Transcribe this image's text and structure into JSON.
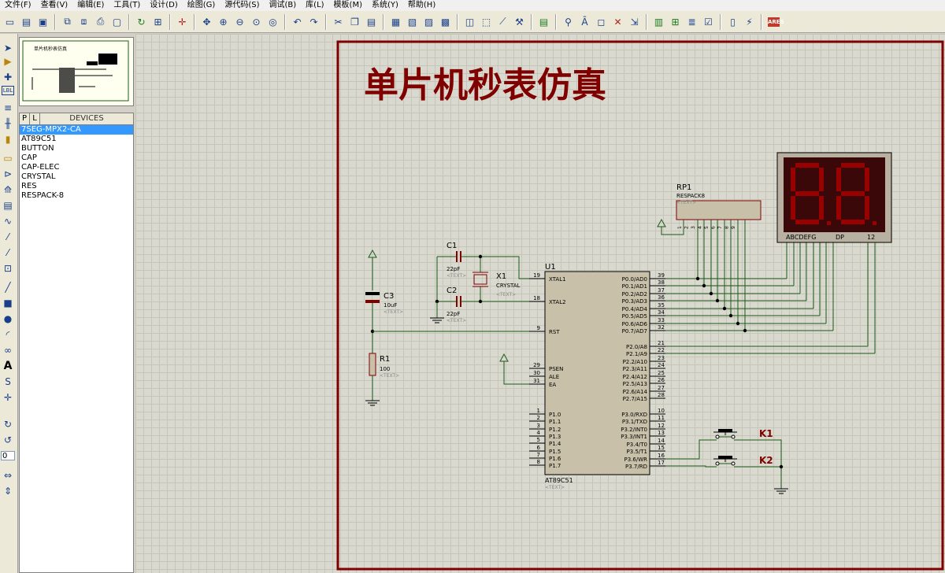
{
  "menu": [
    "文件(F)",
    "查看(V)",
    "编辑(E)",
    "工具(T)",
    "设计(D)",
    "绘图(G)",
    "源代码(S)",
    "调试(B)",
    "库(L)",
    "模板(M)",
    "系统(Y)",
    "帮助(H)"
  ],
  "left_tool_value": "0",
  "panel": {
    "tab_p": "P",
    "tab_l": "L",
    "header": "DEVICES",
    "selected_index": 0,
    "devices": [
      "7SEG-MPX2-CA",
      "AT89C51",
      "BUTTON",
      "CAP",
      "CAP-ELEC",
      "CRYSTAL",
      "RES",
      "RESPACK-8"
    ]
  },
  "overview": {
    "title": "单片机秒表仿真"
  },
  "schematic": {
    "title": "单片机秒表仿真",
    "colors": {
      "frame": "#800000",
      "wire": "#1a5c1a",
      "chip_fill": "#c8c0a8",
      "component": "#800000",
      "segment": "#990000",
      "display_bg": "#3a0808"
    },
    "u1": {
      "ref": "U1",
      "name": "AT89C51",
      "text": "<TEXT>",
      "left_pins": [
        {
          "num": "19",
          "name": "XTAL1"
        },
        {
          "num": "18",
          "name": "XTAL2"
        },
        {
          "num": "9",
          "name": "RST"
        },
        {
          "num": "29",
          "name": "PSEN"
        },
        {
          "num": "30",
          "name": "ALE"
        },
        {
          "num": "31",
          "name": "EA"
        },
        {
          "num": "1",
          "name": "P1.0"
        },
        {
          "num": "2",
          "name": "P1.1"
        },
        {
          "num": "3",
          "name": "P1.2"
        },
        {
          "num": "4",
          "name": "P1.3"
        },
        {
          "num": "5",
          "name": "P1.4"
        },
        {
          "num": "6",
          "name": "P1.5"
        },
        {
          "num": "7",
          "name": "P1.6"
        },
        {
          "num": "8",
          "name": "P1.7"
        }
      ],
      "right_pins": [
        {
          "num": "39",
          "name": "P0.0/AD0"
        },
        {
          "num": "38",
          "name": "P0.1/AD1"
        },
        {
          "num": "37",
          "name": "P0.2/AD2"
        },
        {
          "num": "36",
          "name": "P0.3/AD3"
        },
        {
          "num": "35",
          "name": "P0.4/AD4"
        },
        {
          "num": "34",
          "name": "P0.5/AD5"
        },
        {
          "num": "33",
          "name": "P0.6/AD6"
        },
        {
          "num": "32",
          "name": "P0.7/AD7"
        },
        {
          "num": "21",
          "name": "P2.0/A8"
        },
        {
          "num": "22",
          "name": "P2.1/A9"
        },
        {
          "num": "23",
          "name": "P2.2/A10"
        },
        {
          "num": "24",
          "name": "P2.3/A11"
        },
        {
          "num": "25",
          "name": "P2.4/A12"
        },
        {
          "num": "26",
          "name": "P2.5/A13"
        },
        {
          "num": "27",
          "name": "P2.6/A14"
        },
        {
          "num": "28",
          "name": "P2.7/A15"
        },
        {
          "num": "10",
          "name": "P3.0/RXD"
        },
        {
          "num": "11",
          "name": "P3.1/TXD"
        },
        {
          "num": "12",
          "name": "P3.2/INT0"
        },
        {
          "num": "13",
          "name": "P3.3/INT1"
        },
        {
          "num": "14",
          "name": "P3.4/T0"
        },
        {
          "num": "15",
          "name": "P3.5/T1"
        },
        {
          "num": "16",
          "name": "P3.6/WR"
        },
        {
          "num": "17",
          "name": "P3.7/RD"
        }
      ]
    },
    "c1": {
      "ref": "C1",
      "value": "22pF",
      "text": "<TEXT>"
    },
    "c2": {
      "ref": "C2",
      "value": "22pF",
      "text": "<TEXT>"
    },
    "x1": {
      "ref": "X1",
      "value": "CRYSTAL",
      "text": "<TEXT>"
    },
    "c3": {
      "ref": "C3",
      "value": "10uF",
      "text": "<TEXT>"
    },
    "r1": {
      "ref": "R1",
      "value": "100",
      "text": "<TEXT>"
    },
    "rp1": {
      "ref": "RP1",
      "value": "RESPACK8",
      "text": "<TEXT>",
      "pins": [
        "1",
        "2",
        "3",
        "4",
        "5",
        "6",
        "7",
        "8",
        "9"
      ]
    },
    "display": {
      "label_segments": "ABCDEFG",
      "label_dp": "DP",
      "label_digits": "12"
    },
    "k1": {
      "ref": "K1"
    },
    "k2": {
      "ref": "K2"
    }
  }
}
